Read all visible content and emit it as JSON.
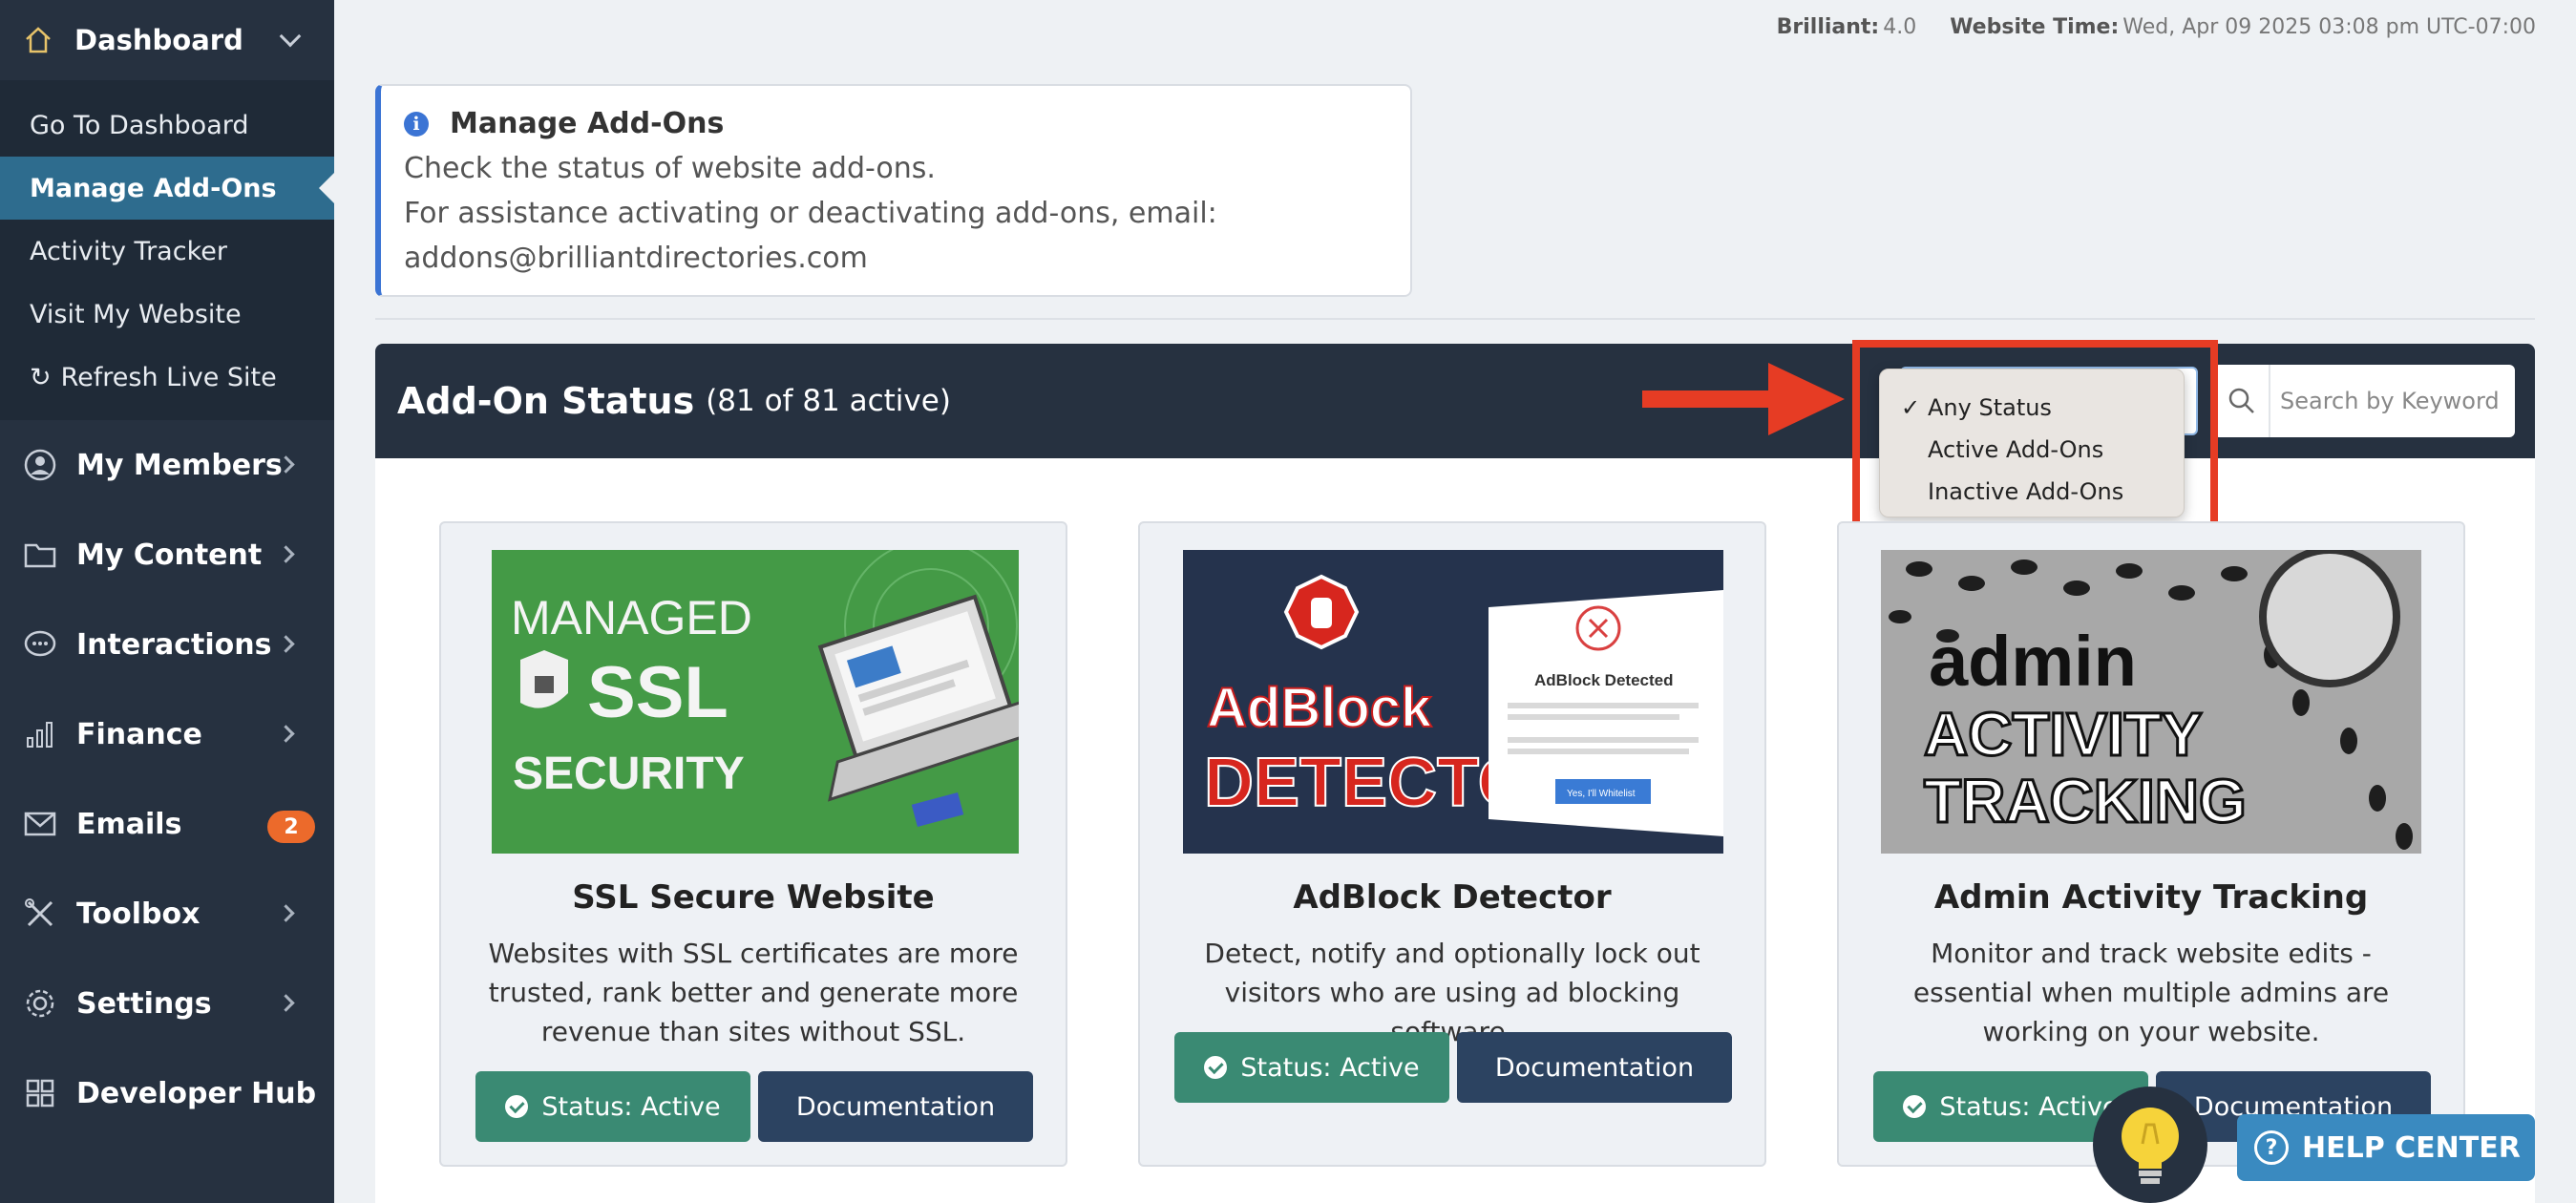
{
  "sidebar": {
    "header_label": "Dashboard",
    "sub_items": [
      {
        "label": "Go To Dashboard"
      },
      {
        "label": "Manage Add-Ons"
      },
      {
        "label": "Activity Tracker"
      },
      {
        "label": "Visit My Website"
      },
      {
        "label": "Refresh Live Site"
      }
    ],
    "nav_items": [
      {
        "label": "My Members",
        "icon": "user-circle-icon"
      },
      {
        "label": "My Content",
        "icon": "folder-icon"
      },
      {
        "label": "Interactions",
        "icon": "chat-bubble-icon"
      },
      {
        "label": "Finance",
        "icon": "bar-chart-icon"
      },
      {
        "label": "Emails",
        "icon": "mail-icon",
        "badge": "2"
      },
      {
        "label": "Toolbox",
        "icon": "tools-icon"
      },
      {
        "label": "Settings",
        "icon": "gear-icon"
      },
      {
        "label": "Developer Hub",
        "icon": "grid-icon"
      }
    ],
    "active_sub_index": 1
  },
  "top_info": {
    "version_label": "Brilliant:",
    "version_value": "4.0",
    "time_label": "Website Time:",
    "time_value": "Wed, Apr 09 2025 03:08 pm UTC-07:00"
  },
  "notice": {
    "title": "Manage Add-Ons",
    "line1": "Check the status of website add-ons.",
    "line2": "For assistance activating or deactivating add-ons, email:",
    "line3": "addons@brilliantdirectories.com"
  },
  "panel": {
    "title": "Add-On Status",
    "count": "(81 of 81 active)",
    "search_placeholder": "Search by Keyword",
    "status_options": [
      {
        "label": "Any Status",
        "selected": true
      },
      {
        "label": "Active Add-Ons",
        "selected": false
      },
      {
        "label": "Inactive Add-Ons",
        "selected": false
      }
    ]
  },
  "cards": [
    {
      "title": "SSL Secure Website",
      "description": "Websites with SSL certificates are more trusted, rank better and generate more revenue than sites without SSL.",
      "status_label": "Status: Active",
      "doc_label": "Documentation",
      "image_text": {
        "line1": "MANAGED",
        "line2": "SSL",
        "line3": "SECURITY"
      }
    },
    {
      "title": "AdBlock Detector",
      "description": "Detect, notify and optionally lock out visitors who are using ad blocking software.",
      "status_label": "Status: Active",
      "doc_label": "Documentation",
      "image_text": {
        "line1": "AdBlock",
        "line2": "DETECTOR",
        "popup_title": "AdBlock Detected",
        "popup_button": "Yes, I'll Whitelist"
      }
    },
    {
      "title": "Admin Activity Tracking",
      "description": "Monitor and track website edits - essential when multiple admins are working on your website.",
      "status_label": "Status: Active",
      "doc_label": "Documentation",
      "image_text": {
        "line1": "admin",
        "line2": "ACTIVITY",
        "line3": "TRACKING"
      }
    }
  ],
  "help": {
    "label": "HELP CENTER"
  },
  "colors": {
    "sidebar_bg": "#263140",
    "active_item": "#2e6c8e",
    "status_green": "#3a8a73",
    "doc_navy": "#2c4361",
    "annotation_red": "#e63c24",
    "badge_orange": "#ec6a2b",
    "help_blue": "#3a8ac0"
  }
}
